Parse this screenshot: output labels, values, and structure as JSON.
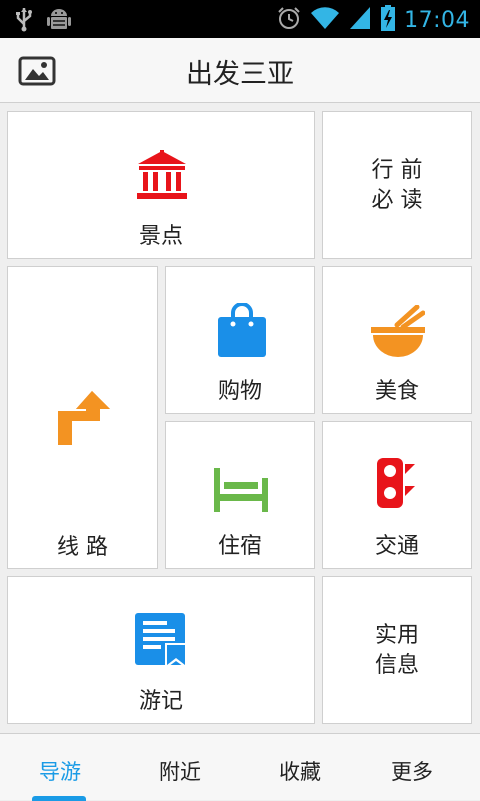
{
  "status_bar": {
    "time": "17:04",
    "left_icons": [
      "usb-icon",
      "android-debug-icon"
    ],
    "right_icons": [
      "alarm-icon",
      "wifi-icon",
      "signal-icon",
      "battery-charging-icon"
    ]
  },
  "header": {
    "title": "出发三亚",
    "left_icon": "image-icon"
  },
  "tiles": {
    "scenic": {
      "label": "景点",
      "icon": "temple-icon",
      "color": "#e8141a"
    },
    "before_trip": {
      "line1": "行 前",
      "line2": "必 读"
    },
    "routes": {
      "label": "线 路",
      "icon": "route-arrow-icon",
      "color": "#f39322"
    },
    "shopping": {
      "label": "购物",
      "icon": "shopping-bag-icon",
      "color": "#1a8fe8"
    },
    "food": {
      "label": "美食",
      "icon": "bowl-chopsticks-icon",
      "color": "#f39322"
    },
    "lodging": {
      "label": "住宿",
      "icon": "bed-icon",
      "color": "#6ab84a"
    },
    "transport": {
      "label": "交通",
      "icon": "traffic-light-icon",
      "color": "#e8141a"
    },
    "travelogue": {
      "label": "游记",
      "icon": "bookmark-document-icon",
      "color": "#1a8fe8"
    },
    "practical_info": {
      "line1": "实用",
      "line2": "信息"
    }
  },
  "tabs": [
    {
      "label": "导游",
      "active": true
    },
    {
      "label": "附近",
      "active": false
    },
    {
      "label": "收藏",
      "active": false
    },
    {
      "label": "更多",
      "active": false
    }
  ],
  "colors": {
    "accent": "#1a9be6",
    "status_accent": "#33b5e5"
  }
}
